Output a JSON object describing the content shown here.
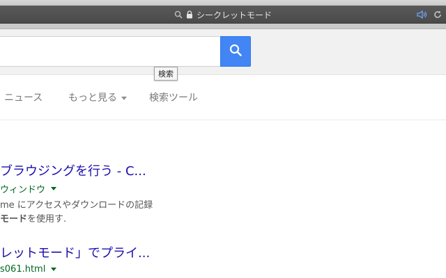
{
  "browser": {
    "address_label": "シークレットモード",
    "icons": [
      "search-icon",
      "lock-icon",
      "speaker-icon",
      "reload-icon"
    ]
  },
  "search": {
    "value": "",
    "button_icon": "search-icon",
    "tooltip": "検索"
  },
  "tabs": {
    "news": "ニュース",
    "more": "もっと見る",
    "tools": "検索ツール"
  },
  "results": [
    {
      "title": "ブラウジングを行う - C...",
      "url": "ウィンドウ",
      "snippet_line1": "me にアクセスやダウンロードの記録",
      "snippet_line2_bold": "モード",
      "snippet_line2_rest": "を使用す."
    },
    {
      "title": "レットモード」でプライ...",
      "url": "s061.html"
    }
  ],
  "colors": {
    "link": "#1a0dab",
    "url": "#006621",
    "accent": "#4285f4"
  }
}
